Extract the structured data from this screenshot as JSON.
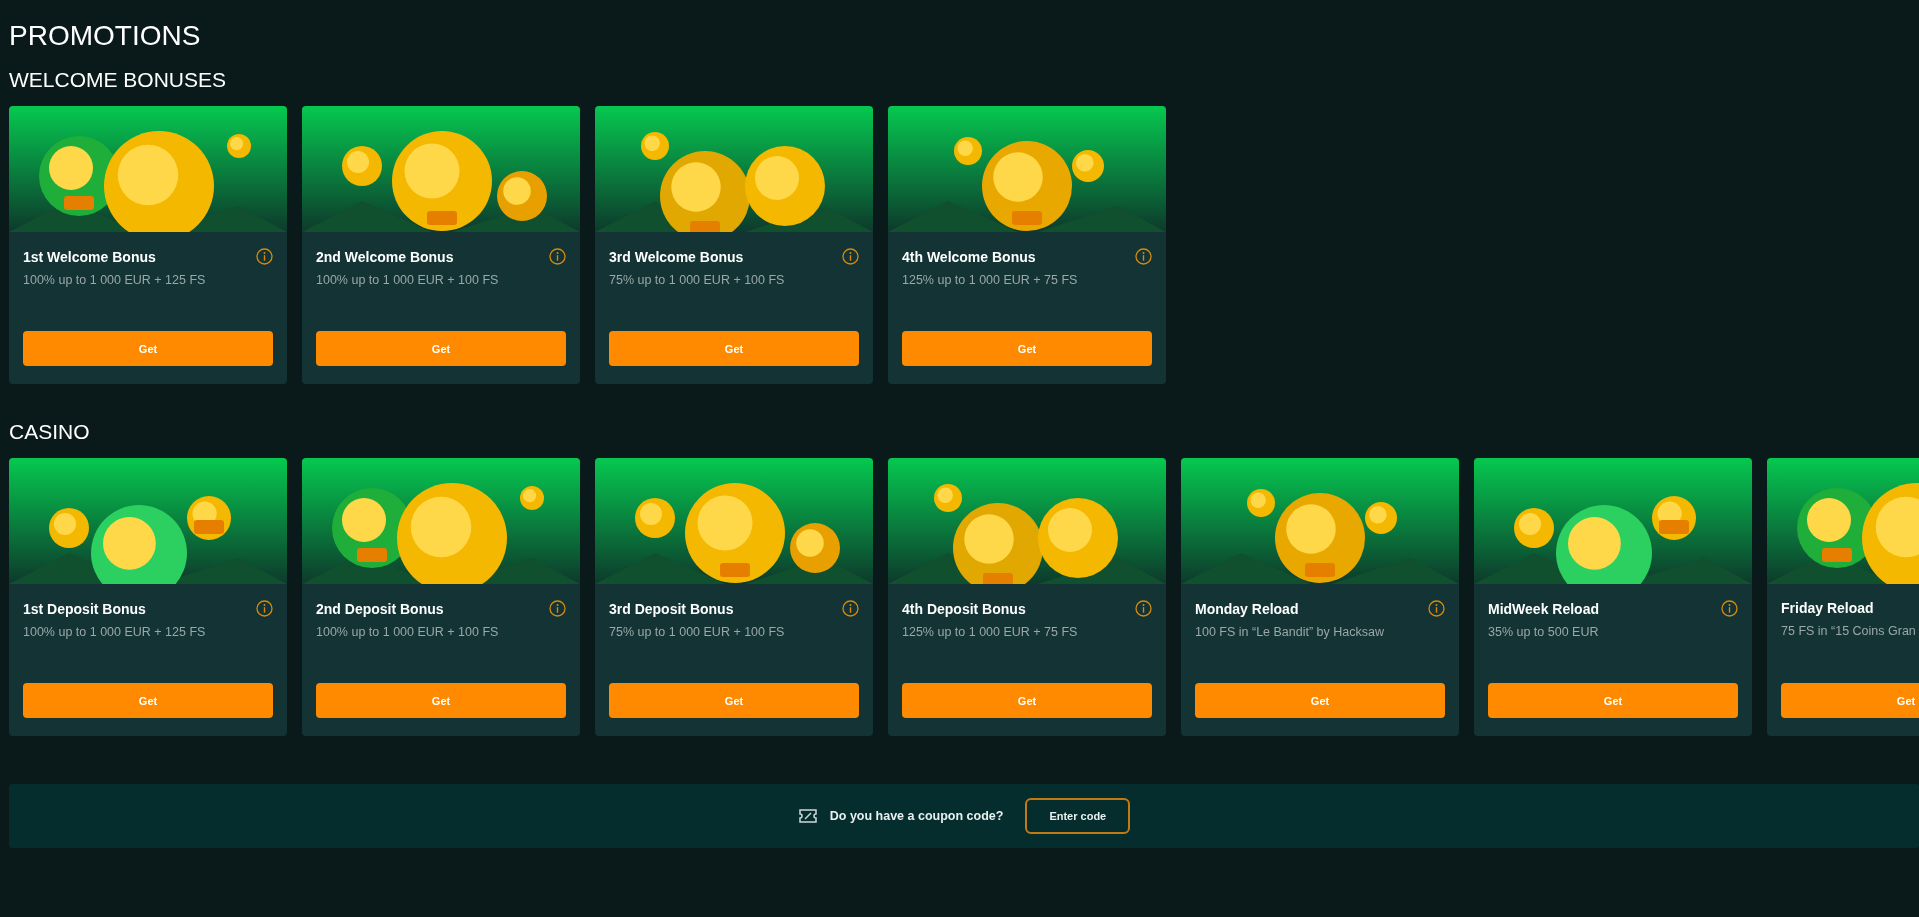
{
  "page_title": "PROMOTIONS",
  "sections": [
    {
      "heading": "WELCOME BONUSES",
      "cards": [
        {
          "title": "1st Welcome Bonus",
          "description": "100% up to 1 000 EUR + 125 FS",
          "button": "Get"
        },
        {
          "title": "2nd Welcome Bonus",
          "description": "100% up to 1 000 EUR + 100 FS",
          "button": "Get"
        },
        {
          "title": "3rd Welcome Bonus",
          "description": "75% up to 1 000 EUR + 100 FS",
          "button": "Get"
        },
        {
          "title": "4th Welcome Bonus",
          "description": "125% up to 1 000 EUR + 75 FS",
          "button": "Get"
        }
      ]
    },
    {
      "heading": "CASINO",
      "cards": [
        {
          "title": "1st Deposit Bonus",
          "description": "100% up to 1 000 EUR + 125 FS",
          "button": "Get"
        },
        {
          "title": "2nd Deposit Bonus",
          "description": "100% up to 1 000 EUR + 100 FS",
          "button": "Get"
        },
        {
          "title": "3rd Deposit Bonus",
          "description": "75% up to 1 000 EUR + 100 FS",
          "button": "Get"
        },
        {
          "title": "4th Deposit Bonus",
          "description": "125% up to 1 000 EUR + 75 FS",
          "button": "Get"
        },
        {
          "title": "Monday Reload",
          "description": "100 FS in “Le Bandit” by Hacksaw",
          "button": "Get"
        },
        {
          "title": "MidWeek Reload",
          "description": "35% up to 500 EUR",
          "button": "Get"
        },
        {
          "title": "Friday Reload",
          "description": "75 FS in “15 Coins Gran",
          "button": "Get",
          "info_hidden": true
        }
      ]
    }
  ],
  "coupon": {
    "question": "Do you have a coupon code?",
    "button": "Enter code"
  }
}
